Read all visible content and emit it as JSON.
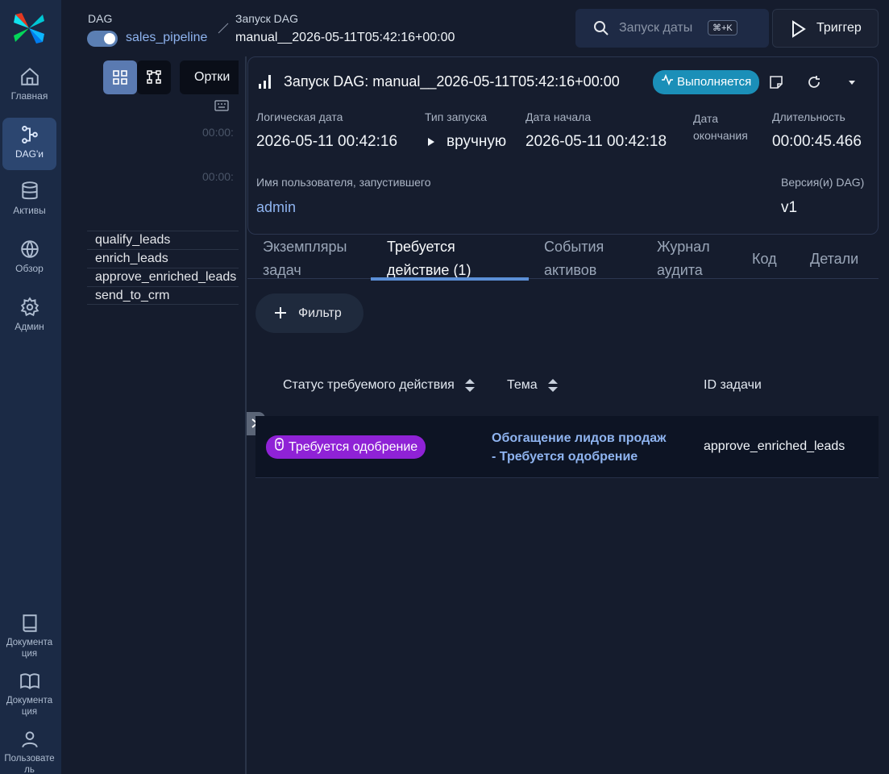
{
  "nav": {
    "items": [
      {
        "label": "Главная",
        "icon": "home-icon"
      },
      {
        "label": "DAG'и",
        "icon": "dag-icon"
      },
      {
        "label": "Активы",
        "icon": "database-icon"
      },
      {
        "label": "Обзор",
        "icon": "globe-icon"
      },
      {
        "label": "Админ",
        "icon": "gear-icon"
      }
    ],
    "bottom": [
      {
        "label": "Документа ция",
        "icon": "book-icon"
      },
      {
        "label": "Документа ция",
        "icon": "open-book-icon"
      },
      {
        "label": "Пользовате ль",
        "icon": "user-icon"
      }
    ]
  },
  "header": {
    "dag_label": "DAG",
    "dag_name": "sales_pipeline",
    "run_label": "Запуск DAG",
    "run_id": "manual__2026-05-11T05:42:16+00:00",
    "search_placeholder": "Запуск даты",
    "search_shortcut": "⌘+K",
    "trigger_label": "Триггер"
  },
  "graph": {
    "orientation_label": "Ортки",
    "time_1": "00:00:",
    "time_2": "00:00:",
    "tasks": [
      "qualify_leads",
      "enrich_leads",
      "approve_enriched_leads",
      "send_to_crm"
    ]
  },
  "run": {
    "title": "Запуск DAG: manual__2026-05-11T05:42:16+00:00",
    "status": "Выполняется",
    "fields": {
      "logical_date_label": "Логическая дата",
      "logical_date": "2026-05-11 00:42:16",
      "run_type_label": "Тип запуска",
      "run_type": "вручную",
      "start_date_label": "Дата начала",
      "start_date": "2026-05-11 00:42:18",
      "end_date_label": "Дата окончания",
      "duration_label": "Длительность",
      "duration": "00:00:45.466",
      "triggered_by_label": "Имя пользователя, запустившего",
      "triggered_by": "admin",
      "version_label": "Версия(и) DAG)",
      "version": "v1"
    }
  },
  "tabs": [
    {
      "label": "Экземпляры задач"
    },
    {
      "label": "Требуется действие (1)"
    },
    {
      "label": "События активов"
    },
    {
      "label": "Журнал аудита"
    },
    {
      "label": "Код"
    },
    {
      "label": "Детали"
    }
  ],
  "filter_label": "Фильтр",
  "table": {
    "headers": {
      "status": "Статус требуемого действия",
      "subject": "Тема",
      "task_id": "ID задачи"
    },
    "rows": [
      {
        "status": "Требуется одобрение",
        "subject_line1": "Обогащение лидов продаж",
        "subject_line2": "- Требуется одобрение",
        "task_id": "approve_enriched_leads"
      }
    ]
  },
  "colors": {
    "accent": "#1b8fb8",
    "pending": "#8f22d6",
    "link": "#8fb4f0"
  }
}
